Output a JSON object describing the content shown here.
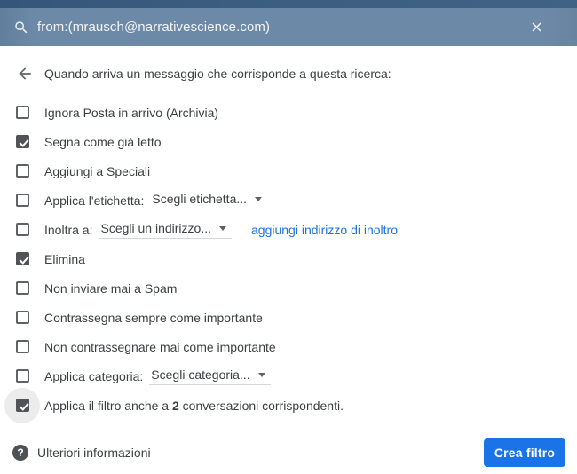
{
  "search_bar": {
    "query": "from:(mrausch@narrativescience.com)"
  },
  "header": {
    "title": "Quando arriva un messaggio che corrisponde a questa ricerca:"
  },
  "filter_options": [
    {
      "label": "Ignora Posta in arrivo (Archivia)",
      "checked": false
    },
    {
      "label": "Segna come già letto",
      "checked": true
    },
    {
      "label": "Aggiungi a Speciali",
      "checked": false
    },
    {
      "label": "Applica l'etichetta:",
      "checked": false,
      "dropdown": "Scegli etichetta..."
    },
    {
      "label": "Inoltra a:",
      "checked": false,
      "dropdown": "Scegli un indirizzo...",
      "link": "aggiungi indirizzo di inoltro"
    },
    {
      "label": "Elimina",
      "checked": true
    },
    {
      "label": "Non inviare mai a Spam",
      "checked": false
    },
    {
      "label": "Contrassegna sempre come importante",
      "checked": false
    },
    {
      "label": "Non contrassegnare mai come importante",
      "checked": false
    },
    {
      "label": "Applica categoria:",
      "checked": false,
      "dropdown": "Scegli categoria..."
    },
    {
      "label": "Applica il filtro anche a ",
      "bold": "2",
      "label_after": " conversazioni corrispondenti.",
      "checked": true,
      "halo": true
    }
  ],
  "footer": {
    "help_label": "Ulteriori informazioni",
    "create_button_label": "Crea filtro"
  },
  "colors": {
    "topbar_dark": "#385a7d",
    "searchbar_bg": "#6d89a8",
    "accent_blue": "#1a73e8",
    "link_blue": "#1a73e8",
    "checkbox_checked": "#525356",
    "text_primary": "#3c4043"
  }
}
